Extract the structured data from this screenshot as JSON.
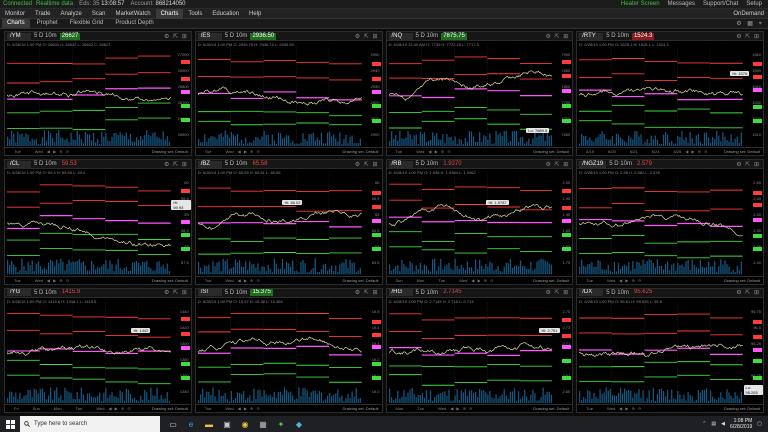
{
  "topbar": {
    "connected": "Connected",
    "realtime": "Realtime data",
    "time_label": "Eds: 35",
    "time": "13:08:57",
    "account_label": "Account:",
    "account": "868214050",
    "heatmap": "Heater Screen",
    "messages": "Messages",
    "support": "Support/Chat",
    "setup": "Setup"
  },
  "menu": {
    "items": [
      "Monitor",
      "Trade",
      "Analyze",
      "Scan",
      "MarketWatch",
      "Charts",
      "Tools",
      "Education",
      "Help"
    ],
    "active": "Charts",
    "ondemand": "OnDemand"
  },
  "subtabs": {
    "items": [
      "Charts",
      "Prophet",
      "Flexible Grid",
      "Product Depth"
    ],
    "active": "Charts"
  },
  "colors": {
    "resistance": "#ff3b3b",
    "support": "#3fdc3f",
    "pivot": "#ff55ff",
    "price": "#d8d8a0",
    "volume": "#1d6fa5",
    "up_tag": "#1f6e1f",
    "down_tag": "#8a1c1c"
  },
  "panels": [
    {
      "symbol": "/YM",
      "period": "5 D 10m",
      "price": "26627",
      "dir": "up",
      "info": "D: 6/28/19 1:00 PM  O: 26600  H: 26632  L: 26602  C: 26627",
      "ticks": [
        "27000",
        "26900",
        "26800",
        "26700",
        "26600",
        "26500"
      ],
      "xlabels": [
        "Tue",
        "Wed"
      ],
      "drawing": "Drawing set: Default",
      "callout": "",
      "seed": 1
    },
    {
      "symbol": "/ES",
      "period": "5 D 10m",
      "price": "2936.50",
      "dir": "up",
      "info": "D: 6/28/19 1:00 PM  O: 2935.75  H: 2936.75  L: 2935.50",
      "ticks": [
        "2950",
        "2940",
        "2930",
        "2920",
        "2910",
        "2900"
      ],
      "xlabels": [
        "Tue",
        "Wed"
      ],
      "drawing": "Drawing set: Default",
      "callout": "",
      "seed": 2
    },
    {
      "symbol": "/NQ",
      "period": "5 D 10m",
      "price": "7875.75",
      "dir": "up",
      "info": "D: 6/28/19 12:40 AM  O: 7730  H: 7722.25  L: 7717.5",
      "ticks": [
        "7900",
        "7850",
        "7800",
        "7750",
        "7700",
        "7650"
      ],
      "xlabels": [
        "Tue",
        "Wed"
      ],
      "drawing": "Drawing set: Default",
      "callout": "Lo: 7689.5",
      "seed": 3
    },
    {
      "symbol": "/RTY",
      "period": "5 D 10m",
      "price": "1524.3",
      "dir": "dn",
      "info": "D: 6/28/19 1:00 PM  O: 1525.1  H: 1525.1  L: 1524.3",
      "ticks": [
        "1560",
        "1550",
        "1540",
        "1530",
        "1520",
        "1510"
      ],
      "xlabels": [
        "6/19",
        "6/20",
        "6/21",
        "6/24",
        "6/25"
      ],
      "drawing": "Drawing set: Default",
      "callout": "Hi: 1576",
      "seed": 4
    },
    {
      "symbol": "/CL",
      "period": "5 D 10m",
      "price": "59.53",
      "dir": "dnt",
      "info": "D: 6/28/19 1:00 PM  O: 59.4  H: 59.55  L: 59.4",
      "ticks": [
        "60",
        "59.5",
        "59",
        "58.5",
        "58",
        "57.5"
      ],
      "xlabels": [
        "Tue",
        "Wed"
      ],
      "drawing": "Drawing set: Default",
      "callout": "Hi: 59.93",
      "seed": 5
    },
    {
      "symbol": "/BZ",
      "period": "5 D 10m",
      "price": "65.58",
      "dir": "dnt",
      "info": "D: 6/28/19 1:00 PM  O: 65.59  H: 65.61  L: 65.55",
      "ticks": [
        "66",
        "65.5",
        "65",
        "64.5",
        "64",
        "63.5"
      ],
      "xlabels": [
        "Tue",
        "Wed"
      ],
      "drawing": "Drawing set: Default",
      "callout": "Hi: 66.02",
      "seed": 6
    },
    {
      "symbol": "/RB",
      "period": "5 D 10m",
      "price": "1.9370",
      "dir": "dnt",
      "info": "D: 6/28/19 1:00 PM  O: 1.936  H: 1.9384  L: 1.9362",
      "ticks": [
        "2.00",
        "1.95",
        "1.90",
        "1.85",
        "1.80",
        "1.75"
      ],
      "xlabels": [
        "Sun",
        "Mon",
        "Tue",
        "Wed"
      ],
      "drawing": "Drawing set: Default",
      "callout": "Hi: 1.9787",
      "seed": 7
    },
    {
      "symbol": "/NGZ19",
      "period": "5 D 10m",
      "price": "2.579",
      "dir": "dnt",
      "info": "D: 6/28/19 1:00 PM  O: 2.58  H: 2.582  L: 2.578",
      "ticks": [
        "2.65",
        "2.60",
        "2.55",
        "2.50",
        "2.45",
        "2.40"
      ],
      "xlabels": [
        "Tue",
        "Wed"
      ],
      "drawing": "Drawing set: Default",
      "callout": "",
      "seed": 8
    },
    {
      "symbol": "/YG",
      "period": "5 D 10m",
      "price": "1415.9",
      "dir": "dnt",
      "info": "D: 6/28/19 1:00 PM  O: 1415.6  H: 1416.1  L: 1415.5",
      "ticks": [
        "1440",
        "1420",
        "1400",
        "1380",
        "1360",
        "1340"
      ],
      "xlabels": [
        "Fri",
        "Sun",
        "Mon",
        "Tue",
        "Wed"
      ],
      "drawing": "Drawing set: Default",
      "callout": "Hi: 1442",
      "seed": 9
    },
    {
      "symbol": "/SI",
      "period": "5 D 10m",
      "price": "15.375",
      "dir": "up",
      "info": "D: 6/28/19 1:00 PM  O: 15.37  H: 15.38  L: 15.365",
      "ticks": [
        "15.5",
        "15.4",
        "15.3",
        "15.2",
        "15.1",
        "15.0"
      ],
      "xlabels": [
        "Tue",
        "Wed"
      ],
      "drawing": "Drawing set: Default",
      "callout": "",
      "seed": 10
    },
    {
      "symbol": "/HG",
      "period": "5 D 10m",
      "price": "2.7145",
      "dir": "dnt",
      "info": "D: 6/28/19 1:00 PM  O: 2.7145  H: 2.716  L: 2.713",
      "ticks": [
        "2.75",
        "2.73",
        "2.71",
        "2.69",
        "2.67",
        "2.65"
      ],
      "xlabels": [
        "Mon",
        "Tue",
        "Wed"
      ],
      "drawing": "Drawing set: Default",
      "callout": "Hi: 2.751",
      "seed": 11
    },
    {
      "symbol": "/DX",
      "period": "5 D 10m",
      "price": "95.625",
      "dir": "dnt",
      "info": "D: 6/28/19 1:00 PM  O: 95.61  H: 95.635  L: 95.6",
      "ticks": [
        "96.75",
        "96.5",
        "96.25",
        "96",
        "95.75",
        "95.5"
      ],
      "xlabels": [
        "Tue",
        "Wed"
      ],
      "drawing": "Drawing set: Default",
      "callout": "Lo: 95.265",
      "seed": 12
    }
  ],
  "taskbar": {
    "search_placeholder": "Type here to search",
    "time": "1:08 PM",
    "date": "6/28/2019"
  }
}
